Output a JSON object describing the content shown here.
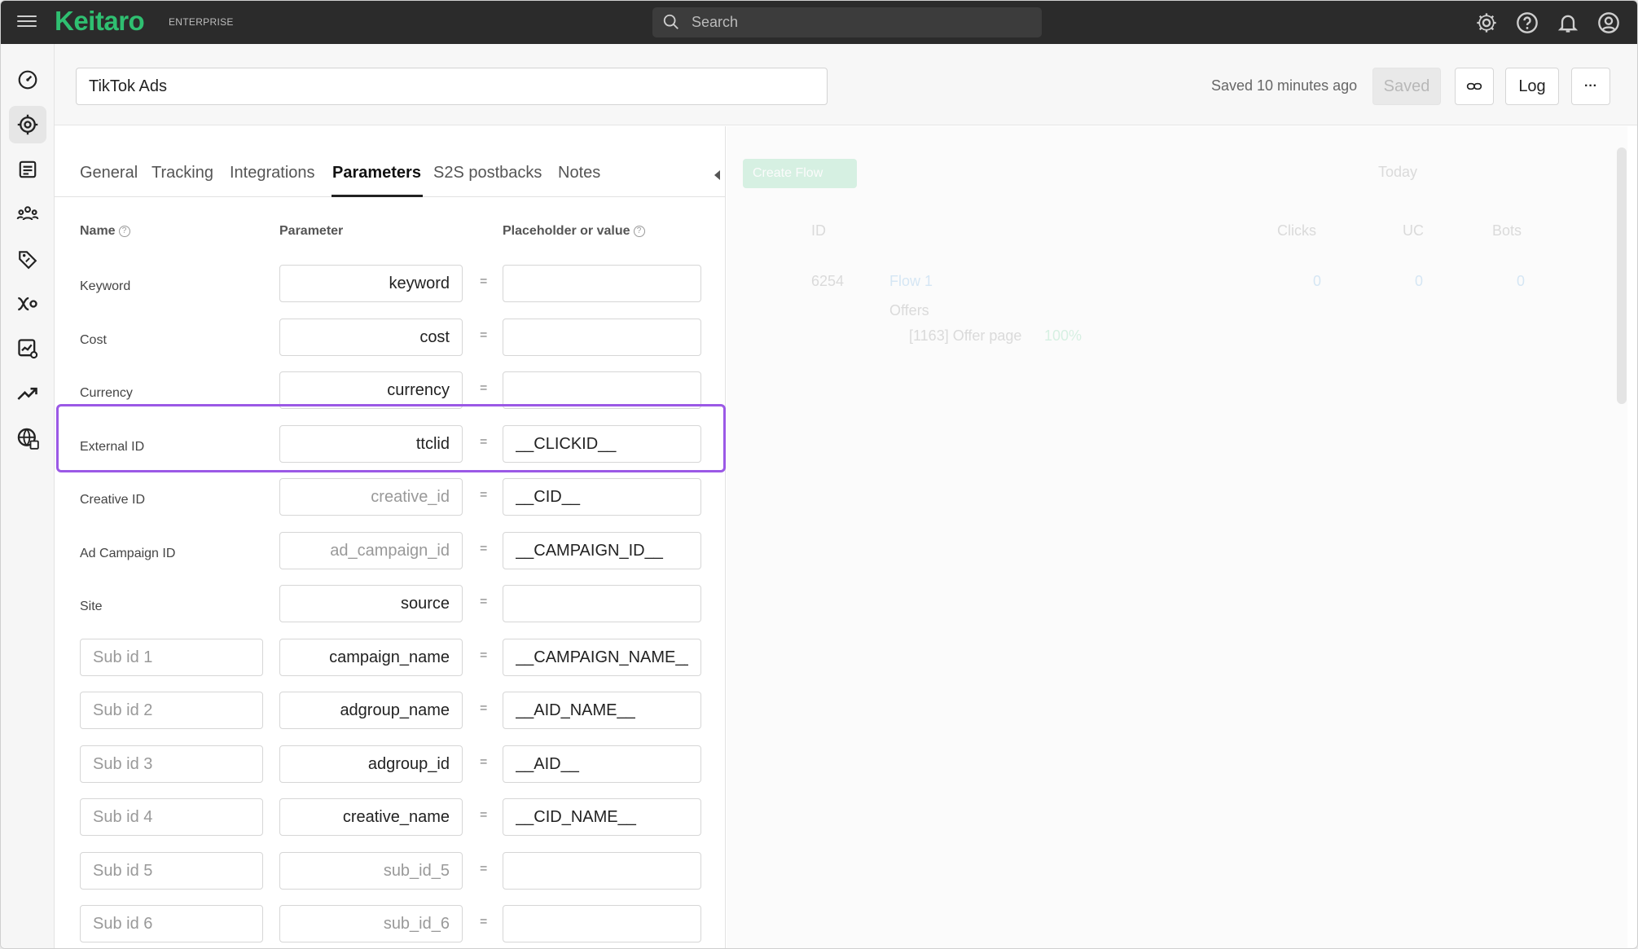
{
  "app": {
    "logo": "Keitaro",
    "edition": "ENTERPRISE",
    "search_placeholder": "Search"
  },
  "header": {
    "campaign_name": "TikTok Ads",
    "saved_status": "Saved 10 minutes ago",
    "saved_button": "Saved",
    "log_button": "Log",
    "more_button": "···"
  },
  "tabs": [
    {
      "label": "General"
    },
    {
      "label": "Tracking"
    },
    {
      "label": "Integrations"
    },
    {
      "label": "Parameters",
      "active": true
    },
    {
      "label": "S2S postbacks"
    },
    {
      "label": "Notes"
    }
  ],
  "columns": {
    "name": "Name",
    "parameter": "Parameter",
    "value": "Placeholder or value"
  },
  "rows": [
    {
      "name": "Keyword",
      "param": "keyword",
      "param_placeholder": "",
      "value": "",
      "value_placeholder": ""
    },
    {
      "name": "Cost",
      "param": "cost",
      "param_placeholder": "",
      "value": "",
      "value_placeholder": ""
    },
    {
      "name": "Currency",
      "param": "currency",
      "param_placeholder": "",
      "value": "",
      "value_placeholder": ""
    },
    {
      "name": "External ID",
      "param": "ttclid",
      "param_placeholder": "",
      "value": "__CLICKID__",
      "value_placeholder": ""
    },
    {
      "name": "Creative ID",
      "param": "",
      "param_placeholder": "creative_id",
      "value": "__CID__",
      "value_placeholder": ""
    },
    {
      "name": "Ad Campaign ID",
      "param": "",
      "param_placeholder": "ad_campaign_id",
      "value": "__CAMPAIGN_ID__",
      "value_placeholder": ""
    },
    {
      "name": "Site",
      "param": "source",
      "param_placeholder": "",
      "value": "",
      "value_placeholder": ""
    },
    {
      "name_placeholder": "Sub id 1",
      "param": "campaign_name",
      "param_placeholder": "",
      "value": "__CAMPAIGN_NAME__",
      "value_placeholder": ""
    },
    {
      "name_placeholder": "Sub id 2",
      "param": "adgroup_name",
      "param_placeholder": "",
      "value": "__AID_NAME__",
      "value_placeholder": ""
    },
    {
      "name_placeholder": "Sub id 3",
      "param": "adgroup_id",
      "param_placeholder": "",
      "value": "__AID__",
      "value_placeholder": ""
    },
    {
      "name_placeholder": "Sub id 4",
      "param": "creative_name",
      "param_placeholder": "",
      "value": "__CID_NAME__",
      "value_placeholder": ""
    },
    {
      "name_placeholder": "Sub id 5",
      "param": "",
      "param_placeholder": "sub_id_5",
      "value": "",
      "value_placeholder": ""
    },
    {
      "name_placeholder": "Sub id 6",
      "param": "",
      "param_placeholder": "sub_id_6",
      "value": "",
      "value_placeholder": ""
    }
  ],
  "equals_sign": "=",
  "background_panel": {
    "create_flow_button": "Create Flow",
    "date_filter": "Today",
    "table_headers": [
      "ID",
      "Clicks",
      "UC",
      "Bots"
    ],
    "flow": {
      "id": "6254",
      "name": "Flow 1",
      "clicks": "0",
      "uc": "0",
      "bots": "0",
      "offers_label": "Offers",
      "offer_name": "[1163] Offer page",
      "offer_share": "100%"
    }
  },
  "colors": {
    "brand": "#2fbf71",
    "highlight": "#9b59e6",
    "topbar": "#2b2b2b"
  },
  "icons": {
    "sidebar": [
      "dashboard-icon",
      "campaigns-icon",
      "landings-icon",
      "affiliate-networks-icon",
      "offers-icon",
      "flows-icon",
      "reports-icon",
      "trends-icon",
      "domains-icon"
    ],
    "topbar": [
      "settings-icon",
      "help-icon",
      "notifications-icon",
      "profile-icon"
    ]
  }
}
